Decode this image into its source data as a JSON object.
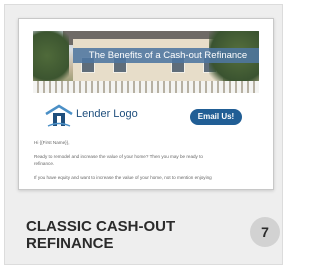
{
  "template_card": {
    "title_line1": "CLASSIC CASH-OUT",
    "title_line2": "REFINANCE",
    "badge_count": "7",
    "preview": {
      "banner_text": "The Benefits of a Cash-out Refinance",
      "logo_text": "Lender Logo",
      "email_button": "Email Us!",
      "greeting": "Hi {{First Name}},",
      "body_line1": "Ready to remodel and increase the value of your home? Then you may be ready to",
      "body_line2": "refinance.",
      "body_line3": "If you have equity and want to increase the value of your home, not to mention enjoying"
    },
    "colors": {
      "accent": "#215e95",
      "banner": "#4e76a0",
      "badge": "#d2d2d2",
      "card": "#eeeeee"
    }
  }
}
